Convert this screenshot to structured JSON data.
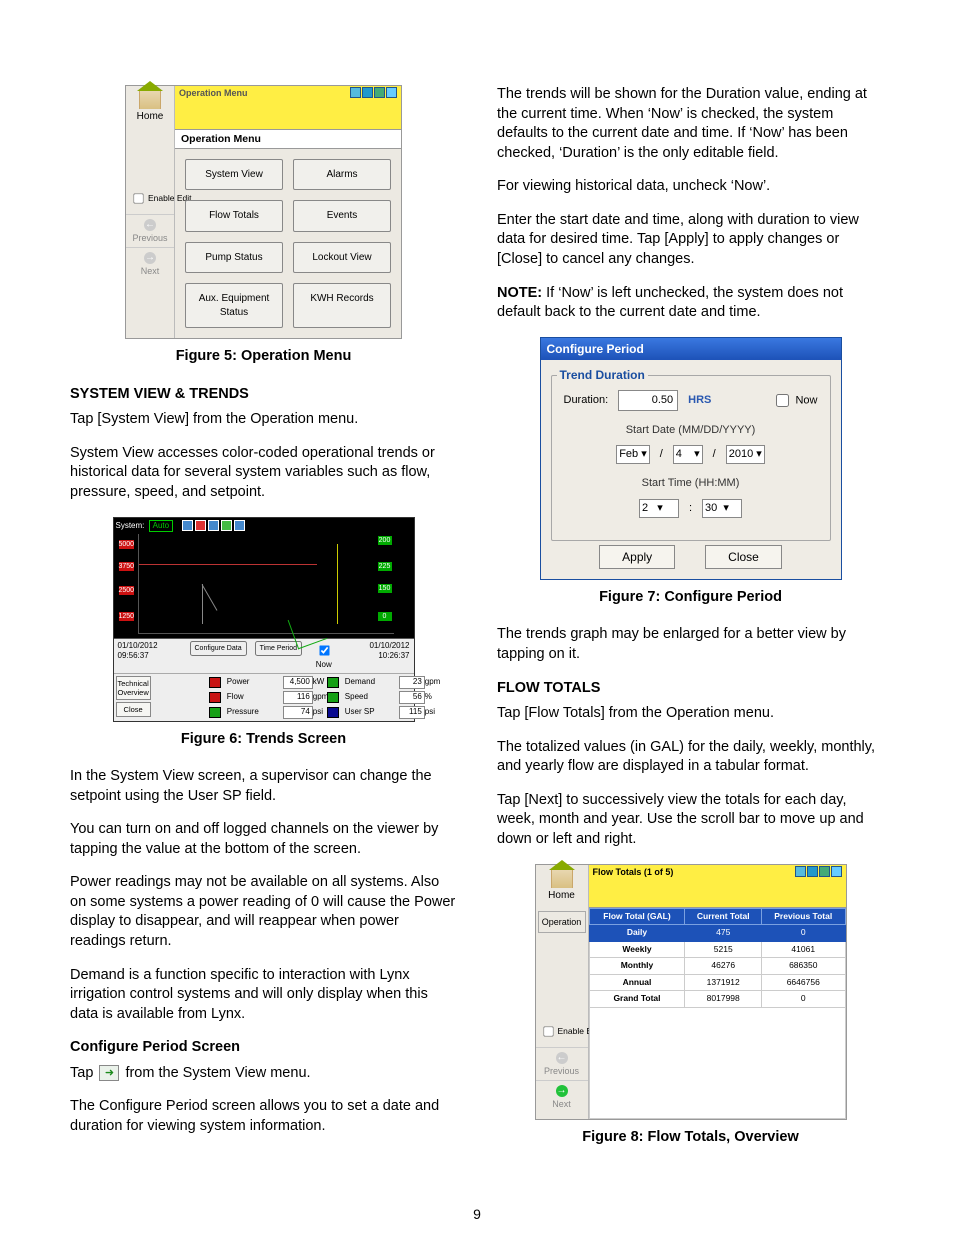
{
  "page_number": "9",
  "left": {
    "fig5": {
      "header": "Operation Menu",
      "subheader": "Operation Menu",
      "side": {
        "home": "Home",
        "enable": "Enable Edit",
        "prev": "Previous",
        "next": "Next"
      },
      "buttons": [
        "System View",
        "Alarms",
        "Flow Totals",
        "Events",
        "Pump Status",
        "Lockout View",
        "Aux. Equipment Status",
        "KWH Records"
      ],
      "caption": "Figure 5: Operation Menu"
    },
    "h1": "SYSTEM VIEW & TRENDS",
    "p1": "Tap [System View] from the Operation menu.",
    "p2": "System View accesses color-coded operational trends or historical data for several system variables such as flow, pressure, speed, and setpoint.",
    "fig6": {
      "system": "System:",
      "auto": "Auto",
      "startTs": "01/10/2012",
      "startTm": "09:56:37",
      "endTs": "01/10/2012",
      "endTm": "10:26:37",
      "btns": {
        "cfg": "Configure Data",
        "tp": "Time Period",
        "now": "Now"
      },
      "side": {
        "tech": "Technical Overview",
        "close": "Close"
      },
      "rows": [
        {
          "c": "#c81414",
          "n": "Power",
          "v": "4,500",
          "u": "kW",
          "c2": "#16a016",
          "n2": "Demand",
          "v2": "23",
          "u2": "gpm"
        },
        {
          "c": "#c81414",
          "n": "Flow",
          "v": "116",
          "u": "gpm",
          "c2": "#16a016",
          "n2": "Speed",
          "v2": "56",
          "u2": "%"
        },
        {
          "c": "#16a016",
          "n": "Pressure",
          "v": "74",
          "u": "psi",
          "c2": "#0a0a90",
          "n2": "User SP",
          "v2": "115",
          "u2": "psi"
        }
      ],
      "caption": "Figure 6: Trends Screen"
    },
    "p3": "In the System View screen, a supervisor can change the setpoint using the User SP field.",
    "p4": "You can turn on and off logged channels on the viewer by tapping the value at the bottom of the screen.",
    "p5": "Power readings may not be available on all systems. Also on some systems a power reading of 0 will cause the Power display to disappear, and will reappear when power readings return.",
    "p6": "Demand is a function specific to interaction with Lynx irrigation control systems and will only display when this data is available from Lynx.",
    "h2": "Configure Period Screen",
    "p7a": "Tap ",
    "p7b": " from the System View menu.",
    "p8": "The Configure Period screen allows you to set a date and duration for viewing system information."
  },
  "right": {
    "p1": "The trends will be shown for the Duration value, ending at the current time. When ‘Now’ is checked, the system defaults to the current date and time. If ‘Now’ has been checked, ‘Duration’ is the only editable field.",
    "p2": "For viewing historical data, uncheck ‘Now’.",
    "p3": "Enter the start date and time, along with duration to view data for desired time. Tap [Apply] to apply changes or [Close] to cancel any changes.",
    "noteLead": "NOTE:",
    "note": " If ‘Now’ is left unchecked, the system does not default back to the current date and time.",
    "fig7": {
      "title": "Configure Period",
      "legend": "Trend Duration",
      "durLbl": "Duration:",
      "durVal": "0.50",
      "hrs": "HRS",
      "now": "Now",
      "sdate": "Start Date (MM/DD/YYYY)",
      "mon": "Feb",
      "day": "4",
      "year": "2010",
      "stime": "Start Time (HH:MM)",
      "hh": "2",
      "mm": "30",
      "apply": "Apply",
      "close": "Close",
      "caption": "Figure 7: Configure Period"
    },
    "p4": "The trends graph may be enlarged for a better view by tapping on it.",
    "h1": "FLOW TOTALS",
    "p5": "Tap [Flow Totals] from the Operation menu.",
    "p6": "The totalized values (in GAL) for the daily, weekly, monthly, and yearly flow are displayed in a tabular format.",
    "p7": "Tap [Next] to successively view the totals for each day, week, month and year. Use the scroll bar to move up and down or left and right.",
    "fig8": {
      "header": "Flow Totals (1 of 5)",
      "side": {
        "home": "Home",
        "op": "Operation",
        "enable": "Enable Edit",
        "prev": "Previous",
        "next": "Next"
      },
      "cols": [
        "Flow Total (GAL)",
        "Current Total",
        "Previous Total"
      ],
      "rows": [
        {
          "l": "Daily",
          "c": "475",
          "p": "0",
          "hi": true
        },
        {
          "l": "Weekly",
          "c": "5215",
          "p": "41061"
        },
        {
          "l": "Monthly",
          "c": "46276",
          "p": "686350"
        },
        {
          "l": "Annual",
          "c": "1371912",
          "p": "6646756"
        },
        {
          "l": "Grand Total",
          "c": "8017998",
          "p": "0"
        }
      ],
      "caption": "Figure 8: Flow Totals, Overview"
    }
  }
}
